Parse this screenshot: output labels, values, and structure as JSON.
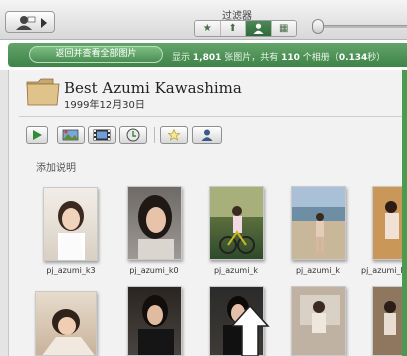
{
  "toolbar": {
    "filter_label": "过滤器",
    "filter_buttons": [
      "★",
      "⬆",
      "👤",
      "▦"
    ],
    "active_filter": 2
  },
  "banner": {
    "return_label": "返回并查看全部图片",
    "status_prefix": "显示",
    "photo_count": "1,801",
    "status_mid1": "张图片，共有",
    "album_count": "110",
    "status_mid2": "个相册（",
    "seconds": "0.134",
    "status_suffix": "秒）"
  },
  "album": {
    "title": "Best Azumi Kawashima",
    "date": "1999年12月30日",
    "add_description": "添加说明"
  },
  "thumbnails_row1": [
    {
      "label": "pj_azumi_k3"
    },
    {
      "label": "pj_azumi_k0"
    },
    {
      "label": "pj_azumi_k"
    },
    {
      "label": "pj_azumi_k"
    },
    {
      "label": "pj_azumi_k"
    }
  ],
  "colors": {
    "accent_green": "#3f8348",
    "background": "#f2f2f2"
  }
}
